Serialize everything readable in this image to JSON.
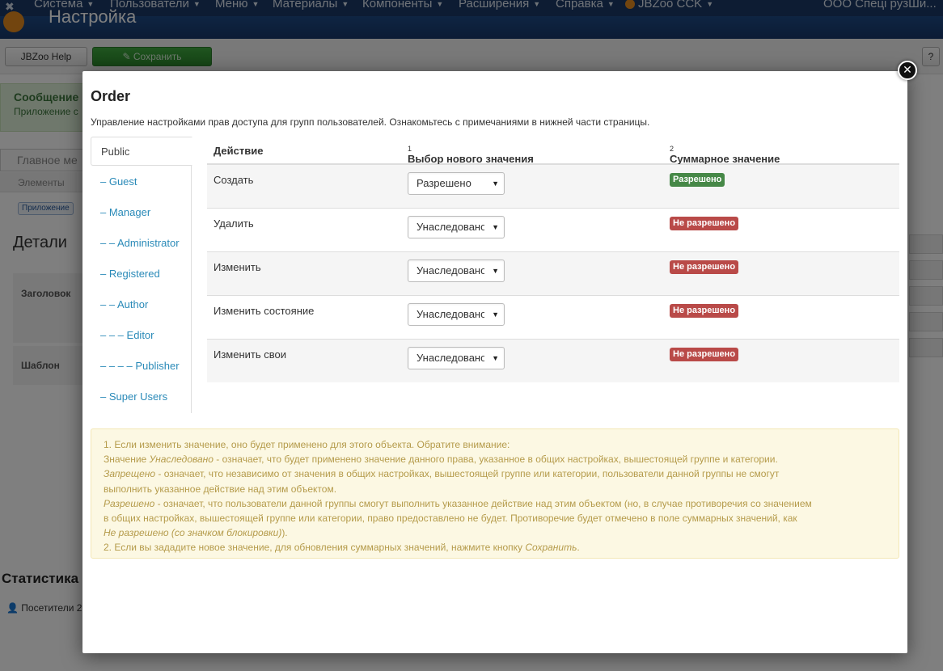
{
  "background": {
    "topnav": {
      "items": [
        "Система",
        "Пользователи",
        "Меню",
        "Материалы",
        "Компоненты",
        "Расширения",
        "Справка",
        "JBZoo CCK"
      ],
      "site_name": "ООО Спецi рузШи..."
    },
    "header_title": "Настройка",
    "toolbar": {
      "help_label": "JBZoo Help",
      "save_label": "Сохранить",
      "help_icon": "?"
    },
    "alert": {
      "title": "Сообщение",
      "text": "Приложение с"
    },
    "tab": "Главное ме",
    "subtab": "Элементы",
    "badge": "Приложение",
    "details_title": "Детали",
    "field_title": "Заголовок",
    "field_template": "Шаблон",
    "stats_title": "Статистика",
    "visitors": "Посетители 2"
  },
  "modal": {
    "close_icon": "close-icon",
    "title": "Order",
    "description": "Управление настройками прав доступа для групп пользователей. Ознакомьтесь с примечаниями в нижней части страницы.",
    "groups": [
      "Public",
      "– Guest",
      "– Manager",
      "– – Administrator",
      "– Registered",
      "– – Author",
      "– – – Editor",
      "– – – – Publisher",
      "– Super Users"
    ],
    "active_group": "Public",
    "table": {
      "col_action": "Действие",
      "col_new_value": "Выбор нового значения",
      "col_new_value_note": "1",
      "col_calculated": "Суммарное значение",
      "col_calculated_note": "2",
      "rows": [
        {
          "action": "Создать",
          "select": "Разрешено",
          "status": "Разрешено",
          "status_color": "#468847"
        },
        {
          "action": "Удалить",
          "select": "Унаследовано",
          "status": "Не разрешено",
          "status_color": "#b94a48"
        },
        {
          "action": "Изменить",
          "select": "Унаследовано",
          "status": "Не разрешено",
          "status_color": "#b94a48"
        },
        {
          "action": "Изменить состояние",
          "select": "Унаследовано",
          "status": "Не разрешено",
          "status_color": "#b94a48"
        },
        {
          "action": "Изменить свои",
          "select": "Унаследовано",
          "status": "Не разрешено",
          "status_color": "#b94a48"
        }
      ]
    },
    "notes": {
      "line1": "1. Если изменить значение, оно будет применено для этого объекта. Обратите внимание:",
      "line2_pre": "Значение ",
      "line2_em": "Унаследовано",
      "line2_post": " - означает, что будет применено значение данного права, указанное в общих настройках, вышестоящей группе и категории.",
      "line3_em": "Запрещено",
      "line3_post": " - означает, что независимо от значения в общих настройках, вышестоящей группе или категории, пользователи данной группы не смогут",
      "line4": "выполнить указанное действие над этим объектом.",
      "line5_em": "Разрешено",
      "line5_post": " - означает, что пользователи данной группы смогут выполнить указанное действие над этим объектом (но, в случае противоречия со значением",
      "line6": "в общих настройках, вышестоящей группе или категории, право предоставлено не будет. Противоречие будет отмечено в поле суммарных значений, как",
      "line7_em": "Не разрешено (со значком блокировки)",
      "line7_post": ").",
      "line8_pre": "2. Если вы зададите новое значение, для обновления суммарных значений, нажмите кнопку ",
      "line8_em": "Сохранить",
      "line8_post": "."
    }
  }
}
